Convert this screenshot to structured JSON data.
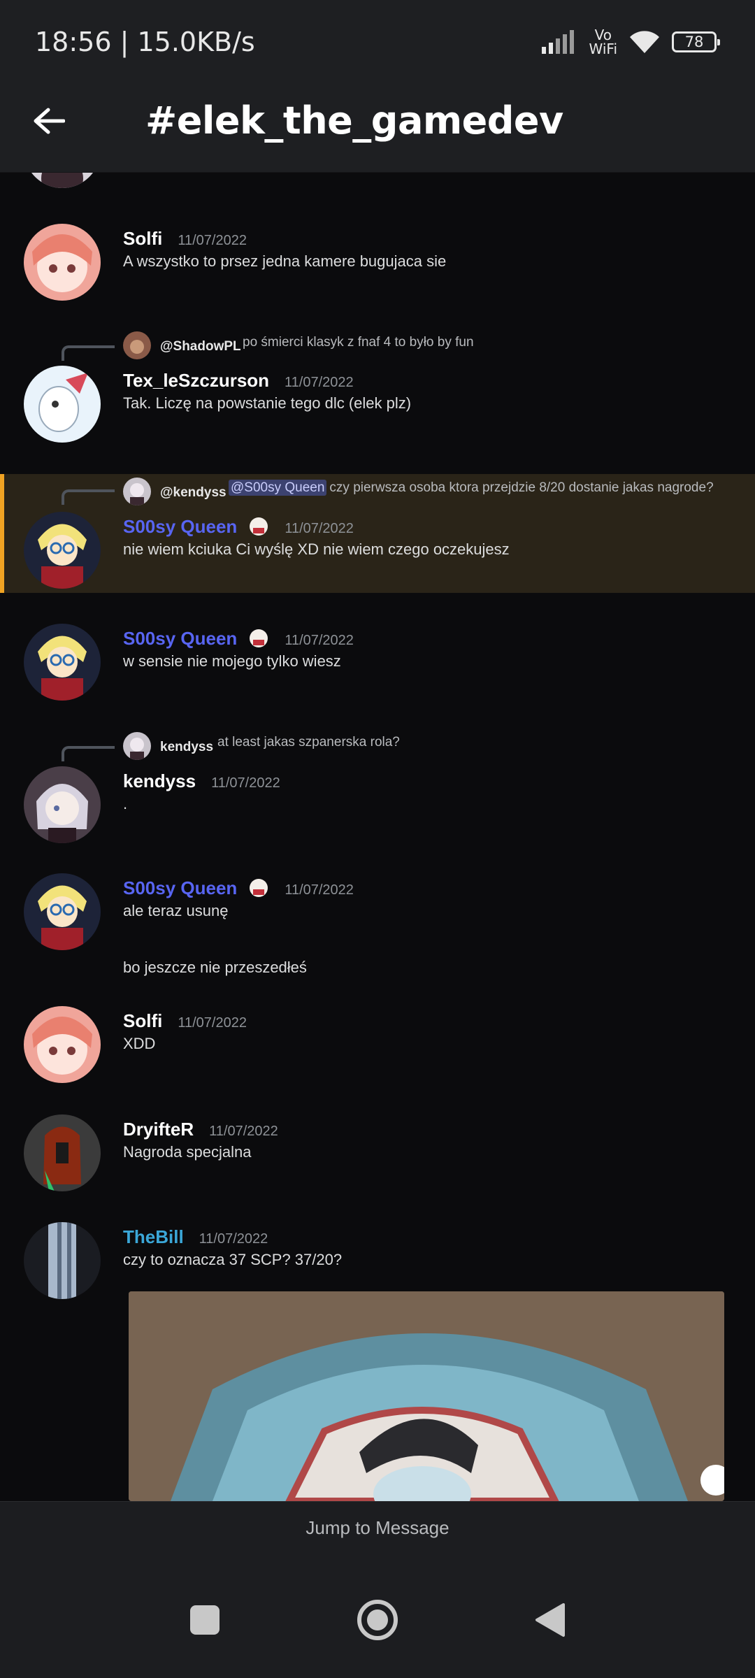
{
  "status": {
    "time": "18:56 | 15.0KB/s",
    "network_label_top": "Vo",
    "network_label_bottom": "WiFi",
    "battery": "78"
  },
  "header": {
    "channel": "#elek_the_gamedev"
  },
  "messages": [
    {
      "author": "Solfi",
      "time": "11/07/2022",
      "text": "A wszystko to prsez jedna kamere bugujaca sie"
    },
    {
      "reply": {
        "name": "@ShadowPL",
        "text": "po śmierci klasyk z fnaf 4 to było by fun"
      },
      "author": "Tex_leSzczurson",
      "time": "11/07/2022",
      "text": "Tak. Liczę na powstanie tego dlc (elek plz)"
    },
    {
      "reply": {
        "name": "@kendyss",
        "mention": "@S00sy Queen",
        "text": "czy pierwsza osoba ktora przejdzie 8/20 dostanie jakas nagrode?"
      },
      "author": "S00sy Queen",
      "time": "11/07/2022",
      "text": "nie wiem kciuka Ci wyślę XD nie wiem czego oczekujesz"
    },
    {
      "author": "S00sy Queen",
      "time": "11/07/2022",
      "text": "w sensie nie mojego tylko wiesz"
    },
    {
      "reply": {
        "name": "kendyss",
        "text": "at least jakas szpanerska rola?"
      },
      "author": "kendyss",
      "time": "11/07/2022",
      "text": "."
    },
    {
      "author": "S00sy Queen",
      "time": "11/07/2022",
      "text": "ale teraz usunę",
      "text2": "bo jeszcze nie przeszedłeś"
    },
    {
      "author": "Solfi",
      "time": "11/07/2022",
      "text": "XDD"
    },
    {
      "author": "DryifteR",
      "time": "11/07/2022",
      "text": "Nagroda specjalna"
    },
    {
      "author": "TheBill",
      "time": "11/07/2022",
      "text": "czy to oznacza 37 SCP? 37/20?"
    }
  ],
  "jump": {
    "label": "Jump to Message"
  },
  "colors": {
    "accent_highlight": "#f0a323",
    "role_blurple": "#5865f2",
    "role_cyan": "#3ba7d8"
  }
}
